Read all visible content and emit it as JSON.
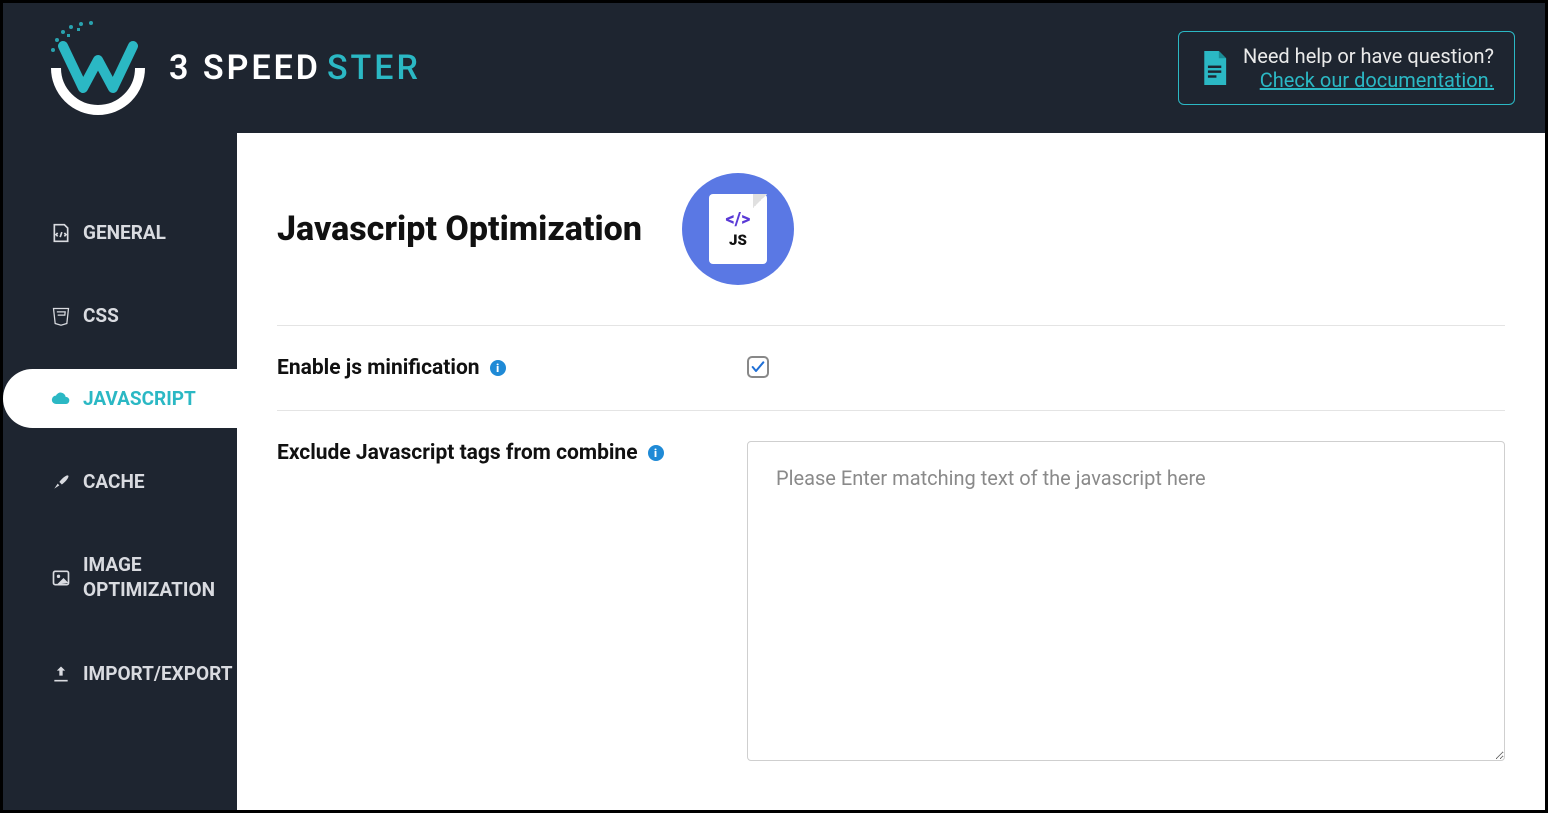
{
  "brand": {
    "part1": "3 SPEED",
    "part2": "STER"
  },
  "help": {
    "line1": "Need help or have question?",
    "line2": "Check our documentation."
  },
  "sidebar": {
    "items": [
      {
        "label": "GENERAL"
      },
      {
        "label": "CSS"
      },
      {
        "label": "JAVASCRIPT"
      },
      {
        "label": "CACHE"
      },
      {
        "label": "IMAGE OPTIMIZATION"
      },
      {
        "label": "IMPORT/EXPORT"
      }
    ]
  },
  "page": {
    "title": "Javascript Optimization",
    "icon_code": "</>",
    "icon_label": "JS"
  },
  "settings": {
    "enable_min": {
      "label": "Enable js minification",
      "checked": true
    },
    "exclude": {
      "label": "Exclude Javascript tags from combine",
      "placeholder": "Please Enter matching text of the javascript here",
      "value": ""
    },
    "info_glyph": "i"
  }
}
